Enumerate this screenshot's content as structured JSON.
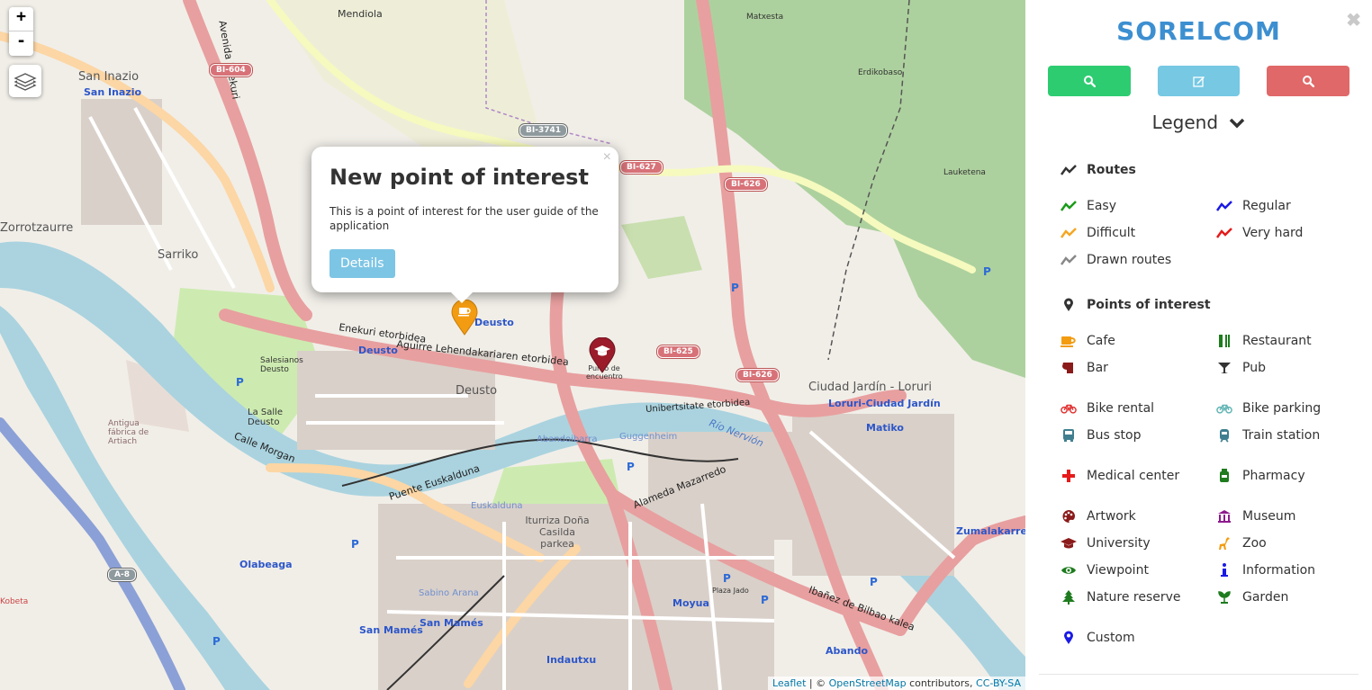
{
  "map": {
    "zoom_in": "+",
    "zoom_out": "-",
    "place_labels": [
      {
        "text": "Mendiola",
        "cls": "",
        "pos": "l1"
      },
      {
        "text": "Matxesta",
        "cls": "",
        "pos": "l2"
      },
      {
        "text": "Erdikobaso",
        "cls": "",
        "pos": "l3"
      },
      {
        "text": "Lauketena",
        "cls": "",
        "pos": "l4"
      },
      {
        "text": "San Inazio",
        "cls": "big",
        "pos": "l5"
      },
      {
        "text": "San Inazio",
        "cls": "blue",
        "pos": "l6"
      },
      {
        "text": "Zorrotzaurre",
        "cls": "big",
        "pos": "l7"
      },
      {
        "text": "Sarriko",
        "cls": "big",
        "pos": "l8"
      },
      {
        "text": "Deusto",
        "cls": "blue",
        "pos": "l9"
      },
      {
        "text": "Deusto",
        "cls": "blue",
        "pos": "l10"
      },
      {
        "text": "Deusto",
        "cls": "big",
        "pos": "l11"
      },
      {
        "text": "Salesianos Deusto",
        "cls": "",
        "pos": "l12"
      },
      {
        "text": "La Salle Deusto",
        "cls": "",
        "pos": "l13"
      },
      {
        "text": "Antigua fábrica de Artiach",
        "cls": "",
        "pos": "l14"
      },
      {
        "text": "Ciudad Jardín - Loruri",
        "cls": "big",
        "pos": "l15"
      },
      {
        "text": "Loruri-Ciudad Jardín",
        "cls": "blue",
        "pos": "l16"
      },
      {
        "text": "Matiko",
        "cls": "blue",
        "pos": "l17"
      },
      {
        "text": "Abandoibarra",
        "cls": "",
        "pos": "l18"
      },
      {
        "text": "Guggenheim",
        "cls": "",
        "pos": "l19"
      },
      {
        "text": "Euskalduna",
        "cls": "",
        "pos": "l20"
      },
      {
        "text": "Iturriza Doña Casilda parkea",
        "cls": "",
        "pos": "l21"
      },
      {
        "text": "Olabeaga",
        "cls": "blue",
        "pos": "l22"
      },
      {
        "text": "Sabino Arana",
        "cls": "",
        "pos": "l23"
      },
      {
        "text": "San Mamés",
        "cls": "blue",
        "pos": "l24"
      },
      {
        "text": "San Mamés",
        "cls": "blue",
        "pos": "l25"
      },
      {
        "text": "Indautxu",
        "cls": "blue",
        "pos": "l26"
      },
      {
        "text": "Moyua",
        "cls": "blue",
        "pos": "l27"
      },
      {
        "text": "Abando",
        "cls": "blue",
        "pos": "l28"
      },
      {
        "text": "Zumalakarregi",
        "cls": "blue",
        "pos": "l29"
      },
      {
        "text": "Unibertsitate etorbidea",
        "cls": "road",
        "pos": "l30"
      },
      {
        "text": "Alameda Mazarredo",
        "cls": "road",
        "pos": "l31"
      },
      {
        "text": "Ibañez de Bilbao kalea",
        "cls": "road",
        "pos": "l32"
      },
      {
        "text": "Aguirre Lehendakariaren etorbidea",
        "cls": "road",
        "pos": "l33"
      },
      {
        "text": "Enekuri etorbidea",
        "cls": "road",
        "pos": "l34"
      },
      {
        "text": "Calle Morgan",
        "cls": "road",
        "pos": "l35"
      },
      {
        "text": "Puente Euskalduna",
        "cls": "road",
        "pos": "l36"
      },
      {
        "text": "Avenida Enekuri",
        "cls": "road",
        "pos": "l37"
      },
      {
        "text": "Punto de encuentro",
        "cls": "",
        "pos": "l38"
      },
      {
        "text": "Río Nervión",
        "cls": "blue",
        "pos": "l39"
      },
      {
        "text": "Kobeta",
        "cls": "",
        "pos": "l40"
      },
      {
        "text": "Plaza Jado",
        "cls": "",
        "pos": "l41"
      }
    ],
    "shields": [
      {
        "text": "BI-604",
        "cls": "",
        "pos": "s1"
      },
      {
        "text": "BI-3741",
        "cls": "gray",
        "pos": "s2"
      },
      {
        "text": "BI-627",
        "cls": "",
        "pos": "s3"
      },
      {
        "text": "BI-626",
        "cls": "",
        "pos": "s4"
      },
      {
        "text": "BI-625",
        "cls": "",
        "pos": "s5"
      },
      {
        "text": "BI-626",
        "cls": "",
        "pos": "s6"
      },
      {
        "text": "A-8",
        "cls": "gray",
        "pos": "s7"
      }
    ],
    "popup": {
      "title": "New point of interest",
      "text": "This is a point of interest for the user guide of the application",
      "button": "Details",
      "close": "×"
    },
    "attribution": {
      "leaflet": "Leaflet",
      "sep": " | © ",
      "osm": "OpenStreetMap",
      "contributors": " contributors, ",
      "license": "CC-BY-SA"
    }
  },
  "panel": {
    "title": "SORELCOM",
    "close": "✖",
    "buttons": [
      {
        "name": "search-routes-button",
        "color": "#2ecc71",
        "icon": "search-icon"
      },
      {
        "name": "edit-button",
        "color": "#76c8e3",
        "icon": "edit-icon"
      },
      {
        "name": "search-poi-button",
        "color": "#e06868",
        "icon": "search-icon"
      }
    ],
    "legend_title": "Legend",
    "routes_header": "Routes",
    "routes": [
      {
        "label": "Easy",
        "color": "#1a9b1a"
      },
      {
        "label": "Regular",
        "color": "#1a1ae6"
      },
      {
        "label": "Difficult",
        "color": "#f5a623"
      },
      {
        "label": "Very hard",
        "color": "#e61a1a"
      },
      {
        "label": "Drawn routes",
        "color": "#888888"
      }
    ],
    "poi_header": "Points of interest",
    "poi": [
      {
        "label": "Cafe",
        "color": "#f39c12",
        "icon": "cafe-icon"
      },
      {
        "label": "Restaurant",
        "color": "#1e7b1e",
        "icon": "restaurant-icon"
      },
      {
        "label": "Bar",
        "color": "#8b1a1a",
        "icon": "bar-icon"
      },
      {
        "label": "Pub",
        "color": "#333333",
        "icon": "pub-icon"
      },
      {
        "label": "Bike rental",
        "color": "#e03030",
        "icon": "bike-rental-icon"
      },
      {
        "label": "Bike parking",
        "color": "#5fb3b3",
        "icon": "bike-parking-icon"
      },
      {
        "label": "Bus stop",
        "color": "#3f7f8f",
        "icon": "bus-stop-icon"
      },
      {
        "label": "Train station",
        "color": "#3f7f8f",
        "icon": "train-station-icon"
      },
      {
        "label": "Medical center",
        "color": "#e61a1a",
        "icon": "medical-center-icon"
      },
      {
        "label": "Pharmacy",
        "color": "#1e7b1e",
        "icon": "pharmacy-icon"
      },
      {
        "label": "Artwork",
        "color": "#8b1a1a",
        "icon": "artwork-icon"
      },
      {
        "label": "Museum",
        "color": "#8e1a8e",
        "icon": "museum-icon"
      },
      {
        "label": "University",
        "color": "#8b1a1a",
        "icon": "university-icon"
      },
      {
        "label": "Zoo",
        "color": "#f39c12",
        "icon": "zoo-icon"
      },
      {
        "label": "Viewpoint",
        "color": "#1e7b1e",
        "icon": "viewpoint-icon"
      },
      {
        "label": "Information",
        "color": "#1a1ae6",
        "icon": "information-icon"
      },
      {
        "label": "Nature reserve",
        "color": "#1e7b1e",
        "icon": "nature-reserve-icon"
      },
      {
        "label": "Garden",
        "color": "#1e7b1e",
        "icon": "garden-icon"
      },
      {
        "label": "Custom",
        "color": "#1a1ae6",
        "icon": "custom-icon"
      }
    ]
  }
}
